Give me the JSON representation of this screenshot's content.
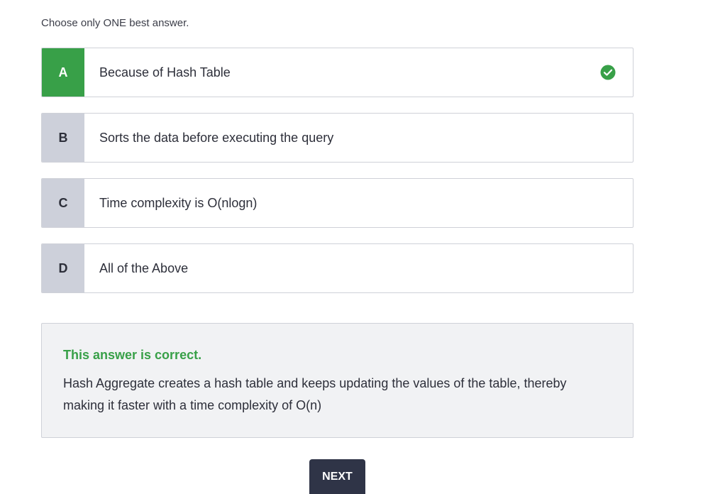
{
  "instruction": "Choose only ONE best answer.",
  "options": [
    {
      "letter": "A",
      "text": "Because of Hash Table",
      "state": "correct"
    },
    {
      "letter": "B",
      "text": "Sorts the data before executing the query"
    },
    {
      "letter": "C",
      "text": "Time complexity is O(nlogn)"
    },
    {
      "letter": "D",
      "text": "All of the Above"
    }
  ],
  "feedback": {
    "title": "This answer is correct.",
    "text": "Hash Aggregate creates a hash table and keeps updating the values of the table, thereby making it faster with a time complexity of O(n)"
  },
  "next_label": "NEXT",
  "colors": {
    "correct": "#38a048",
    "letter_bg": "#cdd0da",
    "button_bg": "#2f3447",
    "feedback_bg": "#f1f2f4"
  },
  "icons": {
    "correct": "check-circle-icon"
  }
}
